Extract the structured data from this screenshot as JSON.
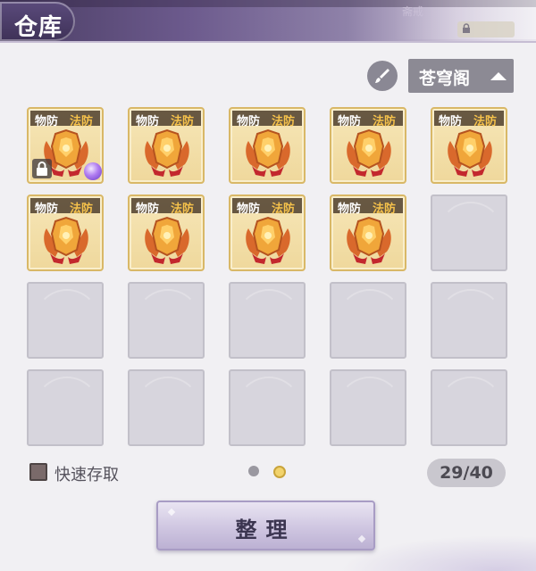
{
  "window": {
    "title": "仓库",
    "header_faint_text": "斋戒"
  },
  "toolbar": {
    "brush_icon": "brush-icon",
    "filter_selected": "苍穹阁"
  },
  "inventory": {
    "items": [
      {
        "tag_physical": "物防",
        "tag_magic": "法防",
        "icon": "armor-icon",
        "locked": true,
        "gem": true
      },
      {
        "tag_physical": "物防",
        "tag_magic": "法防",
        "icon": "armor-icon"
      },
      {
        "tag_physical": "物防",
        "tag_magic": "法防",
        "icon": "armor-icon"
      },
      {
        "tag_physical": "物防",
        "tag_magic": "法防",
        "icon": "armor-icon"
      },
      {
        "tag_physical": "物防",
        "tag_magic": "法防",
        "icon": "armor-icon"
      },
      {
        "tag_physical": "物防",
        "tag_magic": "法防",
        "icon": "armor-icon"
      },
      {
        "tag_physical": "物防",
        "tag_magic": "法防",
        "icon": "armor-icon"
      },
      {
        "tag_physical": "物防",
        "tag_magic": "法防",
        "icon": "armor-icon"
      },
      {
        "tag_physical": "物防",
        "tag_magic": "法防",
        "icon": "armor-icon"
      }
    ],
    "columns": 5,
    "rows": 4
  },
  "footer": {
    "quick_store_label": "快速存取",
    "page_current": 2,
    "page_total": 2,
    "capacity_text": "29/40",
    "sort_button_label": "整理"
  },
  "colors": {
    "accent_gold": "#f6c24b",
    "header_purple": "#4a3d63",
    "slot_empty": "#d7d5dd"
  }
}
